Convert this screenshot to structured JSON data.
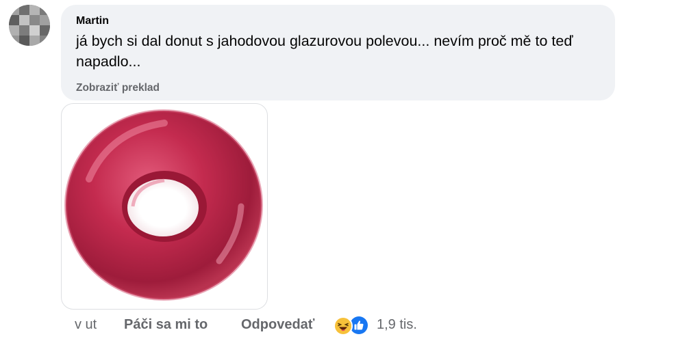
{
  "comment": {
    "author": "Martin",
    "text": "já bych si dal donut s jahodovou glazurovou polevou... nevím proč mě to teď napadlo...",
    "translate_label": "Zobraziť preklad",
    "avatar_icon": "blurred-profile-avatar"
  },
  "attachment": {
    "subject": "strawberry-glazed-donut-image"
  },
  "actions": {
    "time": "v ut",
    "like_label": "Páči sa mi to",
    "reply_label": "Odpovedať",
    "reaction_icons": [
      "haha-icon",
      "like-icon"
    ],
    "reaction_count": "1,9 tis."
  },
  "colors": {
    "bubble": "#f0f2f5",
    "secondary_text": "#65676b",
    "like_blue": "#1877f2",
    "haha_yellow": "#f7c13a",
    "donut": "#c42b4f"
  }
}
